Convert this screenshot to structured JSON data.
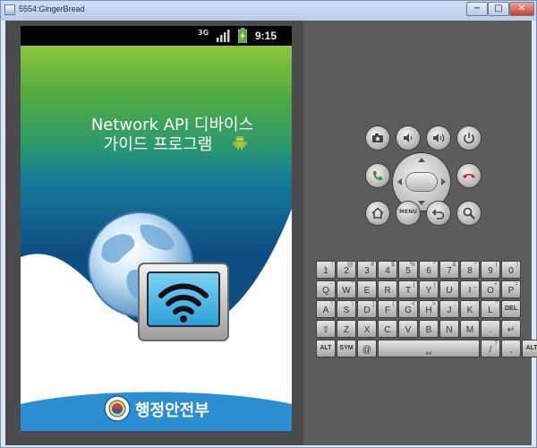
{
  "window": {
    "title": "5554:GingerBread",
    "minimize_glyph": "−",
    "maximize_glyph": "□",
    "close_glyph": "✕"
  },
  "status_bar": {
    "network": "3G",
    "time": "9:15"
  },
  "app": {
    "title_line1": "Network API 디바이스",
    "title_line2": "가이드 프로그램",
    "ministry": "행정안전부"
  },
  "controls": {
    "menu_label": "MENU"
  },
  "keyboard": {
    "rows": [
      [
        {
          "main": "1",
          "alt": "!"
        },
        {
          "main": "2",
          "alt": "@"
        },
        {
          "main": "3",
          "alt": "#"
        },
        {
          "main": "4",
          "alt": "$"
        },
        {
          "main": "5",
          "alt": "%"
        },
        {
          "main": "6",
          "alt": "^"
        },
        {
          "main": "7",
          "alt": "&"
        },
        {
          "main": "8",
          "alt": "*"
        },
        {
          "main": "9",
          "alt": "("
        },
        {
          "main": "0",
          "alt": ")"
        }
      ],
      [
        {
          "main": "Q",
          "alt": "~"
        },
        {
          "main": "W",
          "alt": "\""
        },
        {
          "main": "E",
          "alt": "´"
        },
        {
          "main": "R",
          "alt": "`"
        },
        {
          "main": "T",
          "alt": "{"
        },
        {
          "main": "Y",
          "alt": "}"
        },
        {
          "main": "U",
          "alt": "-"
        },
        {
          "main": "I",
          "alt": "_"
        },
        {
          "main": "O",
          "alt": "+"
        },
        {
          "main": "P",
          "alt": "="
        }
      ],
      [
        {
          "main": "A",
          "alt": "\\"
        },
        {
          "main": "S",
          "alt": "\\"
        },
        {
          "main": "D",
          "alt": "]"
        },
        {
          "main": "F",
          "alt": "["
        },
        {
          "main": "G",
          "alt": "<"
        },
        {
          "main": "H",
          "alt": ">"
        },
        {
          "main": "J",
          "alt": ";"
        },
        {
          "main": "K",
          "alt": ":"
        },
        {
          "main": "L",
          "alt": "\""
        },
        {
          "main": "DEL",
          "alt": ""
        }
      ],
      [
        {
          "main": "⇧",
          "alt": ""
        },
        {
          "main": "Z",
          "alt": ""
        },
        {
          "main": "X",
          "alt": ""
        },
        {
          "main": "C",
          "alt": ""
        },
        {
          "main": "V",
          "alt": ""
        },
        {
          "main": "B",
          "alt": ""
        },
        {
          "main": "N",
          "alt": ""
        },
        {
          "main": "M",
          "alt": ""
        },
        {
          "main": ".",
          "alt": ""
        },
        {
          "main": "↵",
          "alt": ""
        }
      ],
      [
        {
          "main": "ALT",
          "alt": ""
        },
        {
          "main": "SYM",
          "alt": ""
        },
        {
          "main": "@",
          "alt": ""
        },
        {
          "main": "␣",
          "alt": ""
        },
        {
          "main": "/",
          "alt": "?"
        },
        {
          "main": ",",
          "alt": ""
        },
        {
          "main": "ALT",
          "alt": ""
        }
      ]
    ]
  },
  "colors": {
    "accent_green": "#8cc63f",
    "accent_blue": "#0f4e82",
    "footer_blue": "#2a8ed0",
    "call_green": "#2e8b2e",
    "end_red": "#cc2a2a"
  }
}
